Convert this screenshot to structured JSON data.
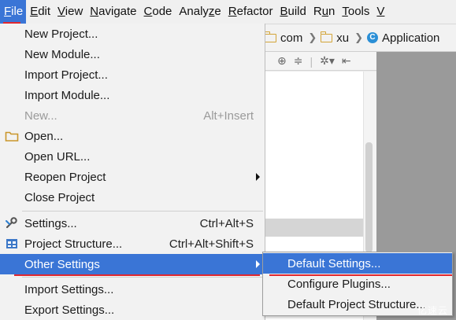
{
  "menubar": {
    "items": [
      {
        "mnemonic": "F",
        "rest": "ile"
      },
      {
        "mnemonic": "E",
        "rest": "dit"
      },
      {
        "mnemonic": "V",
        "rest": "iew"
      },
      {
        "mnemonic": "N",
        "rest": "avigate"
      },
      {
        "mnemonic": "C",
        "rest": "ode"
      },
      {
        "pre": "Analy",
        "mnemonic": "z",
        "rest": "e"
      },
      {
        "mnemonic": "R",
        "rest": "efactor"
      },
      {
        "mnemonic": "B",
        "rest": "uild"
      },
      {
        "pre": "R",
        "mnemonic": "u",
        "rest": "n"
      },
      {
        "mnemonic": "T",
        "rest": "ools"
      },
      {
        "mnemonic": "V",
        "rest": ""
      }
    ]
  },
  "breadcrumb": {
    "items": [
      "com",
      "xu",
      "Application"
    ]
  },
  "file_menu": {
    "items": [
      {
        "label": "New Project..."
      },
      {
        "label": "New Module..."
      },
      {
        "label": "Import Project..."
      },
      {
        "label": "Import Module..."
      },
      {
        "label": "New...",
        "shortcut": "Alt+Insert"
      },
      {
        "label": "Open..."
      },
      {
        "label": "Open URL..."
      },
      {
        "label": "Reopen Project"
      },
      {
        "label": "Close Project"
      },
      {
        "label": "Settings...",
        "shortcut": "Ctrl+Alt+S"
      },
      {
        "label": "Project Structure...",
        "shortcut": "Ctrl+Alt+Shift+S"
      },
      {
        "label": "Other Settings"
      },
      {
        "label": "Import Settings..."
      },
      {
        "label": "Export Settings..."
      }
    ]
  },
  "submenu": {
    "items": [
      {
        "label": "Default Settings..."
      },
      {
        "label": "Configure Plugins..."
      },
      {
        "label": "Default Project Structure..."
      }
    ]
  },
  "watermark": "亿速云",
  "colors": {
    "highlight": "#3a75d6",
    "annotation": "#e0272f",
    "menu_bg": "#f2f2f2"
  }
}
